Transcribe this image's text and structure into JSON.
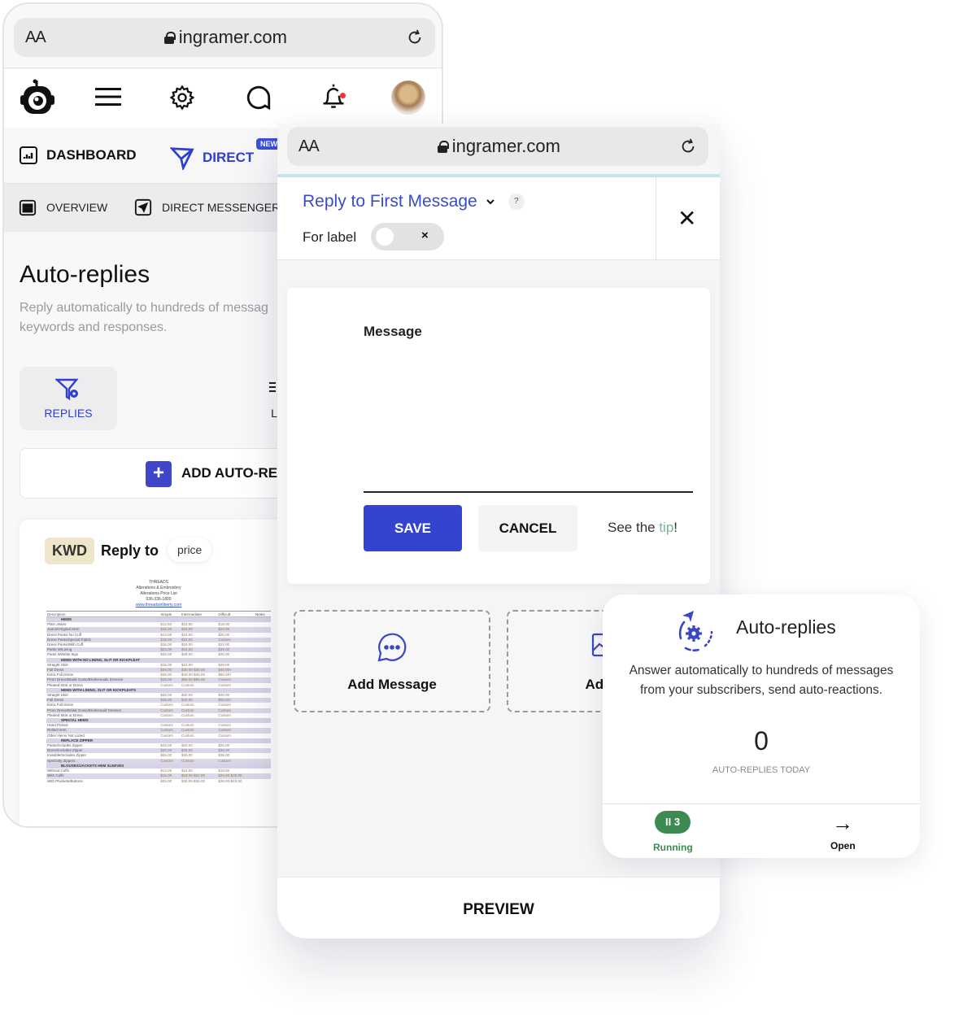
{
  "browser": {
    "text_size_label": "AA",
    "url": "ingramer.com",
    "reload_icon": "reload-icon",
    "lock_icon": "lock-icon"
  },
  "left_phone": {
    "header_icons": [
      "app-logo-icon",
      "hamburger-menu-icon",
      "gear-icon",
      "chat-bubble-icon",
      "bell-icon",
      "avatar"
    ],
    "notification_dot_color": "#e53935",
    "main_tabs": [
      {
        "label": "DASHBOARD",
        "icon": "dashboard-chart-icon",
        "active": false
      },
      {
        "label": "DIRECT",
        "icon": "paper-plane-icon",
        "active": true,
        "badge": "NEW"
      }
    ],
    "sub_tabs": [
      {
        "label": "OVERVIEW",
        "icon": "overview-grid-icon"
      },
      {
        "label": "DIRECT MESSENGER",
        "icon": "messenger-send-icon"
      }
    ],
    "page_title": "Auto-replies",
    "page_description_line1": "Reply automatically to hundreds of messag",
    "page_description_line2": "keywords and responses.",
    "section_tabs": [
      {
        "label": "REPLIES",
        "icon": "filter-gear-icon",
        "active": true
      },
      {
        "label": "L",
        "icon": "list-icon",
        "active": false
      }
    ],
    "add_button_label": "ADD AUTO-RE",
    "rule": {
      "type_badge": "KWD",
      "reply_to_label": "Reply to",
      "keyword": "price"
    },
    "document": {
      "header": [
        "THREADS",
        "Alterations & Embroidery",
        "Alterations Price List",
        "936-336-1800"
      ],
      "link": "www.threadsinliberty.com",
      "columns": [
        "Description",
        "Simple",
        "Intermediate",
        "Difficult",
        "Notes"
      ],
      "rows": [
        {
          "section": "HEMS"
        },
        {
          "cells": [
            "Plain Jeans",
            "$12.50",
            "$15.00",
            "$18.00",
            ""
          ]
        },
        {
          "cells": [
            "Jeans/Original Hem",
            "$15.00",
            "$18.00",
            "$20.00",
            ""
          ]
        },
        {
          "cells": [
            "Dress Pants/ No Cuff",
            "$14.00",
            "$16.00",
            "$20.00",
            ""
          ]
        },
        {
          "cells": [
            "Dress Pants/Special Fabric",
            "$18.00",
            "$22.00",
            "Custom",
            ""
          ]
        },
        {
          "cells": [
            "Dress Pants/With Cuff",
            "$16.00",
            "$18.00",
            "$22.00",
            ""
          ]
        },
        {
          "cells": [
            "Pants W/Lining",
            "$22.00",
            "$24.00",
            "$28.00",
            ""
          ]
        },
        {
          "cells": [
            "Pants W/Wide legs",
            "$25.00",
            "$28.00",
            "$30.00",
            ""
          ]
        },
        {
          "section": "HEMS WITH NO LINING, SLIT OR KICKPLEAT"
        },
        {
          "cells": [
            "Straight Skirt",
            "$16.00",
            "$22.00",
            "$28.00",
            ""
          ]
        },
        {
          "cells": [
            "Full Dress",
            "$25.00",
            "$30.00-$35.00",
            "$40.00+",
            ""
          ]
        },
        {
          "cells": [
            "Extra Full Dress",
            "$35.00",
            "$40.00-$45.00",
            "$50.00+",
            ""
          ]
        },
        {
          "cells": [
            "Prom Dress/Bridal Gown/Bridesmaids Dresses",
            "$45.00",
            "$65.00-$85.00",
            "Custom",
            ""
          ]
        },
        {
          "cells": [
            "Pleated Skirt or Dress",
            "Custom",
            "Custom",
            "Custom",
            ""
          ]
        },
        {
          "section": "HEMS WITH LINING, SLIT OR KICKPLEATS"
        },
        {
          "cells": [
            "Straight Skirt",
            "$25.00",
            "$30.00",
            "$40.00",
            ""
          ]
        },
        {
          "cells": [
            "Full Dress",
            "$35.00",
            "$45.00",
            "$50.00+",
            ""
          ]
        },
        {
          "cells": [
            "Extra Full Dress",
            "Custom",
            "Custom",
            "Custom",
            ""
          ]
        },
        {
          "cells": [
            "Prom Dress/Bridal Gown/Bridesmaid Dresses",
            "Custom",
            "Custom",
            "Custom",
            ""
          ]
        },
        {
          "cells": [
            "Pleated Skirt or Dress",
            "Custom",
            "Custom",
            "Custom",
            ""
          ]
        },
        {
          "section": "SPECIAL HEMS"
        },
        {
          "cells": [
            "Hand Picked",
            "Custom",
            "Custom",
            "Custom",
            ""
          ]
        },
        {
          "cells": [
            "Rolled Hem",
            "Custom",
            "Custom",
            "Custom",
            ""
          ]
        },
        {
          "cells": [
            "Other Hems Not Listed",
            "Custom",
            "Custom",
            "Custom",
            ""
          ]
        },
        {
          "section": "REPLACE ZIPPER"
        },
        {
          "cells": [
            "Pants/Includes Zipper",
            "$15.00",
            "$20.00",
            "$25.00",
            ""
          ]
        },
        {
          "cells": [
            "Dress/Includes Zipper",
            "$20.00",
            "$25.00",
            "$30.00",
            ""
          ]
        },
        {
          "cells": [
            "Invisible/Includes Zipper",
            "$25.00",
            "$30.00",
            "$35.00",
            ""
          ]
        },
        {
          "cells": [
            "Specialty Zippers",
            "Custom",
            "Custom",
            "Custom",
            ""
          ]
        },
        {
          "section": "BLOUSES/JACKETS HEM SLEEVES"
        },
        {
          "cells": [
            "Without Cuffs",
            "$14.00",
            "$16.00",
            "$18.00",
            ""
          ]
        },
        {
          "cells": [
            "With Cuffs",
            "$16.00",
            "$18.00-$22.00",
            "$25.00-$30.00",
            ""
          ]
        },
        {
          "cells": [
            "With Plackets/Buttons",
            "$25.00",
            "$30.00-$35.00",
            "$38.00-$45.00",
            ""
          ]
        }
      ]
    }
  },
  "middle_phone": {
    "reply_type_label": "Reply to First Message",
    "help_label": "?",
    "for_label": "For label",
    "toggle_on": false,
    "toggle_off_symbol": "×",
    "close_icon": "close-icon",
    "close_symbol": "✕",
    "message_label": "Message",
    "message_value": "",
    "save_label": "SAVE",
    "cancel_label": "CANCEL",
    "tip_prefix": "See the ",
    "tip_link": "tip",
    "tip_suffix": "!",
    "add_options": [
      {
        "label": "Add Message",
        "icon": "chat-dots-icon"
      },
      {
        "label": "Add P",
        "icon": "image-icon"
      }
    ],
    "preview_label": "PREVIEW",
    "colors": {
      "accent": "#3444d0",
      "tip_green": "#7ab58c"
    }
  },
  "auto_replies_card": {
    "icon": "auto-reply-gear-plane-icon",
    "title": "Auto-replies",
    "description_line1": "Answer automatically to hundreds of messages",
    "description_line2": "from your subscribers, send auto-reactions.",
    "count": "0",
    "count_label": "AUTO-REPLIES TODAY",
    "running_count": "3",
    "running_symbol": "II",
    "running_label": "Running",
    "open_symbol": "→",
    "open_label": "Open",
    "colors": {
      "running_green": "#3d8a52"
    }
  }
}
